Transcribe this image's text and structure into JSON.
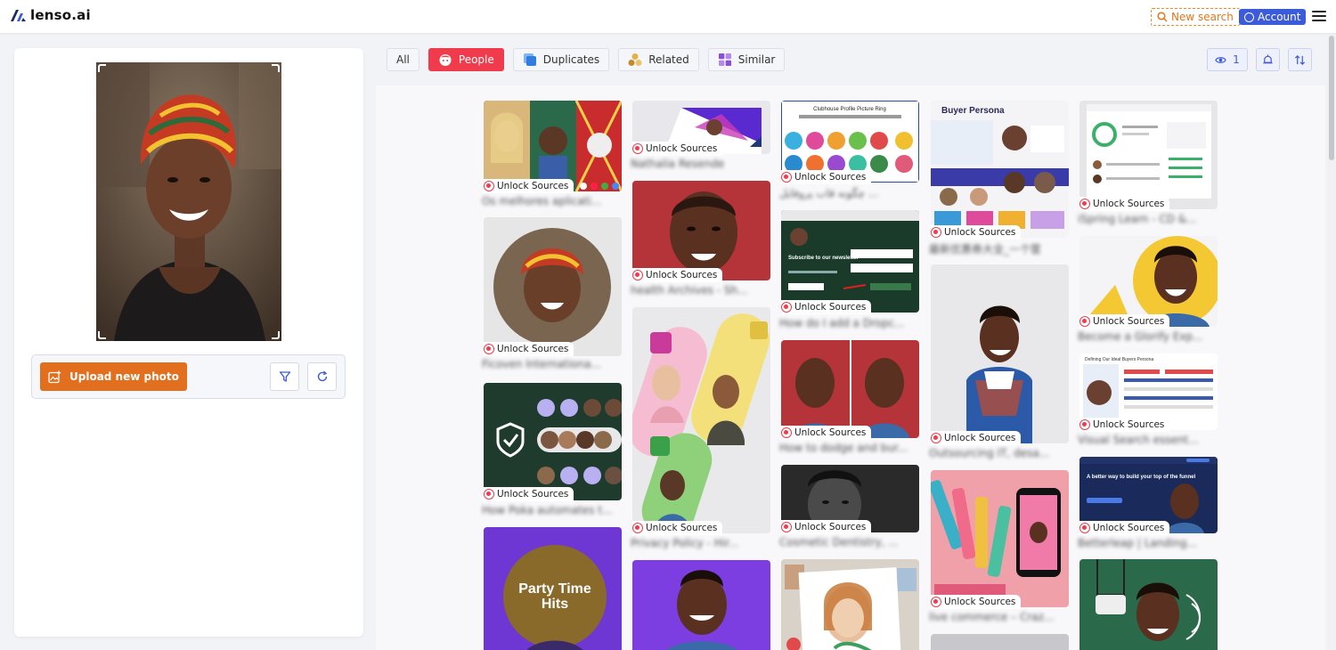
{
  "header": {
    "logo_text": "lenso.ai",
    "new_search_label": "New search",
    "account_label": "Account"
  },
  "left_panel": {
    "upload_label": "Upload new photo"
  },
  "filters": [
    {
      "label": "All",
      "active": false,
      "icon": "none"
    },
    {
      "label": "People",
      "active": true,
      "icon": "face-icon"
    },
    {
      "label": "Duplicates",
      "active": false,
      "icon": "duplicate-icon"
    },
    {
      "label": "Related",
      "active": false,
      "icon": "related-icon"
    },
    {
      "label": "Similar",
      "active": false,
      "icon": "grid-icon"
    }
  ],
  "tools": {
    "view_count": "1"
  },
  "colors": {
    "accent_blue": "#3b5bdb",
    "people_red": "#ef3b4b",
    "upload_orange": "#e26f1e",
    "new_search_orange": "#f08a24"
  },
  "results": {
    "unlock_label": "Unlock Sources",
    "items": [
      {
        "caption": "Os melhores aplicati..."
      },
      {
        "caption": "Ficoven Internationa..."
      },
      {
        "caption": "How Poka automates t..."
      },
      {
        "caption": ""
      },
      {
        "caption": "Nathalia Resende"
      },
      {
        "caption": "health Archives - Sh..."
      },
      {
        "caption": "Privacy Policy - Hir..."
      },
      {
        "caption": ""
      },
      {
        "caption": "چگونه قاب پروفایل ..."
      },
      {
        "caption": "How do I add a Dropc..."
      },
      {
        "caption": "How to dodge and bur..."
      },
      {
        "caption": "Cosmetic Dentistry, ..."
      },
      {
        "caption": ""
      },
      {
        "caption": "最新优惠券大全_一个筐"
      },
      {
        "caption": "Outsourcing IT, desa..."
      },
      {
        "caption": "live commerce – Craz..."
      },
      {
        "caption": ""
      },
      {
        "caption": "iSpring Learn - CD &..."
      },
      {
        "caption": "Become a Glorify Exp..."
      },
      {
        "caption": "Visual Search essent..."
      },
      {
        "caption": "Betterleap | Landing..."
      },
      {
        "caption": ""
      }
    ],
    "thumb_texts": {
      "party_title": "Party Time",
      "party_subtitle": "Hits",
      "clubhouse_title": "Clubhouse Profile Picture Ring",
      "buyer_title": "Buyer Persona",
      "newsletter_title": "Subscribe to our newsletter",
      "ideal_title": "Defining Our Ideal Buyers Persona",
      "betterleap_title": "A better way to build your top of the funnel"
    }
  }
}
